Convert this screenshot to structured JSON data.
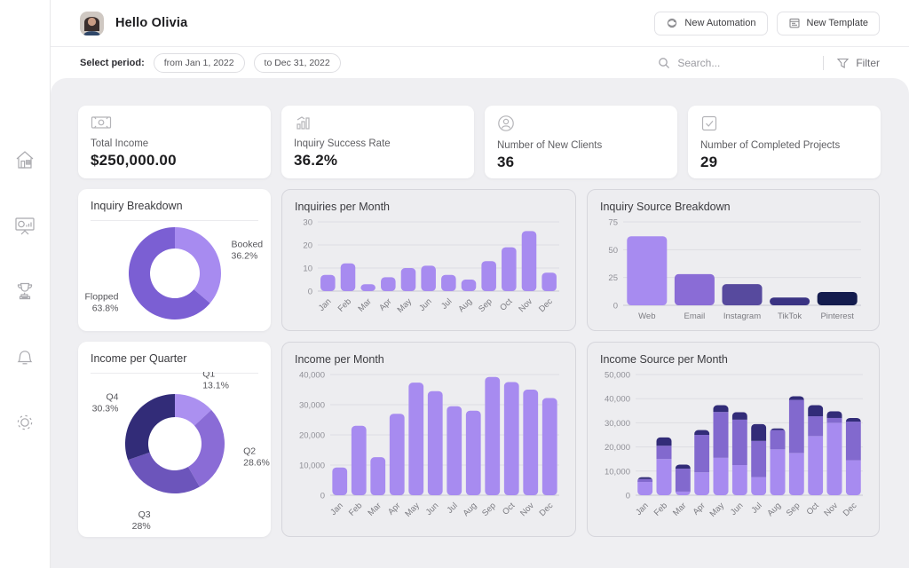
{
  "header": {
    "greeting": "Hello Olivia",
    "new_automation_label": "New Automation",
    "new_template_label": "New Template"
  },
  "toolbar": {
    "select_period_label": "Select period:",
    "period_from": "from Jan 1, 2022",
    "period_to": "to Dec 31, 2022",
    "search_placeholder": "Search...",
    "filter_label": "Filter"
  },
  "sidebar": {
    "items": [
      {
        "id": "home",
        "icon": "home-icon"
      },
      {
        "id": "analytics",
        "icon": "presentation-chart-icon"
      },
      {
        "id": "achievements",
        "icon": "trophy-icon"
      },
      {
        "id": "notifications",
        "icon": "bell-icon"
      },
      {
        "id": "settings",
        "icon": "gear-icon"
      }
    ]
  },
  "kpis": [
    {
      "icon": "banknote-icon",
      "label": "Total Income",
      "value": "$250,000.00"
    },
    {
      "icon": "bar-growth-icon",
      "label": "Inquiry Success Rate",
      "value": "36.2%"
    },
    {
      "icon": "new-client-icon",
      "label": "Number of New Clients",
      "value": "36"
    },
    {
      "icon": "checkbox-icon",
      "label": "Number of Completed Projects",
      "value": "29"
    }
  ],
  "colors": {
    "accent_light": "#a78bf0",
    "accent_mid": "#8269ce",
    "accent_deep": "#6c55bb",
    "accent_dark": "#322c78",
    "navy": "#141c4e",
    "main_bg": "#efeff2",
    "grid": "#dddde3"
  },
  "chart_data": [
    {
      "id": "inquiry-breakdown",
      "type": "pie",
      "donut": true,
      "title": "Inquiry Breakdown",
      "slices": [
        {
          "label": "Booked",
          "value": 36.2,
          "display": "36.2%",
          "color": "#a78bf0"
        },
        {
          "label": "Flopped",
          "value": 63.8,
          "display": "63.8%",
          "color": "#7b5fd3"
        }
      ]
    },
    {
      "id": "inquiries-per-month",
      "type": "bar",
      "title": "Inquiries per Month",
      "categories": [
        "Jan",
        "Feb",
        "Mar",
        "Apr",
        "May",
        "Jun",
        "Jul",
        "Aug",
        "Sep",
        "Oct",
        "Nov",
        "Dec"
      ],
      "values": [
        7,
        12,
        3,
        6,
        10,
        11,
        7,
        5,
        13,
        19,
        26,
        8
      ],
      "ylim": [
        0,
        30
      ],
      "yticks": [
        0,
        10,
        20,
        30
      ],
      "color": "#a78bf0"
    },
    {
      "id": "inquiry-source-breakdown",
      "type": "bar",
      "title": "Inquiry Source Breakdown",
      "categories": [
        "Web",
        "Email",
        "Instagram",
        "TikTok",
        "Pinterest"
      ],
      "values": [
        62,
        28,
        19,
        7,
        12
      ],
      "colors": [
        "#a78bf0",
        "#8a6cd6",
        "#574a9e",
        "#3a3383",
        "#141c4e"
      ],
      "ylim": [
        0,
        75
      ],
      "yticks": [
        0,
        25,
        50,
        75
      ]
    },
    {
      "id": "income-per-quarter",
      "type": "pie",
      "donut": true,
      "title": "Income per Quarter",
      "slices": [
        {
          "label": "Q1",
          "value": 13.1,
          "display": "13.1%",
          "color": "#ab90f0"
        },
        {
          "label": "Q2",
          "value": 28.6,
          "display": "28.6%",
          "color": "#8a6cd6"
        },
        {
          "label": "Q3",
          "value": 28,
          "display": "28%",
          "color": "#6c55bb"
        },
        {
          "label": "Q4",
          "value": 30.3,
          "display": "30.3%",
          "color": "#322c78"
        }
      ]
    },
    {
      "id": "income-per-month",
      "type": "bar",
      "title": "Income per Month",
      "categories": [
        "Jan",
        "Feb",
        "Mar",
        "Apr",
        "May",
        "Jun",
        "Jul",
        "Aug",
        "Sep",
        "Oct",
        "Nov",
        "Dec"
      ],
      "values": [
        9200,
        23000,
        12600,
        27000,
        37300,
        34500,
        29500,
        28000,
        39200,
        37500,
        35000,
        32200
      ],
      "ylim": [
        0,
        40000
      ],
      "yticks": [
        0,
        10000,
        20000,
        30000,
        40000
      ],
      "color": "#a78bf0"
    },
    {
      "id": "income-source-per-month",
      "type": "stacked-bar",
      "title": "Income Source per Month",
      "categories": [
        "Jan",
        "Feb",
        "Mar",
        "Apr",
        "May",
        "Jun",
        "Jul",
        "Aug",
        "Sep",
        "Oct",
        "Nov",
        "Dec"
      ],
      "series": [
        {
          "name": "segment-1",
          "color": "#a78bf0",
          "values": [
            5500,
            15000,
            1500,
            9500,
            15500,
            12500,
            7500,
            19000,
            17500,
            24500,
            30000,
            14500
          ]
        },
        {
          "name": "segment-2",
          "color": "#8269ce",
          "values": [
            1200,
            5500,
            9500,
            15500,
            19000,
            18800,
            15000,
            8000,
            22000,
            8200,
            2000,
            16000
          ]
        },
        {
          "name": "segment-3",
          "color": "#322c78",
          "values": [
            800,
            3500,
            1700,
            2000,
            2800,
            3100,
            7000,
            700,
            1500,
            4600,
            2800,
            1500
          ]
        }
      ],
      "ylim": [
        0,
        50000
      ],
      "yticks": [
        0,
        10000,
        20000,
        30000,
        40000,
        50000
      ]
    }
  ]
}
